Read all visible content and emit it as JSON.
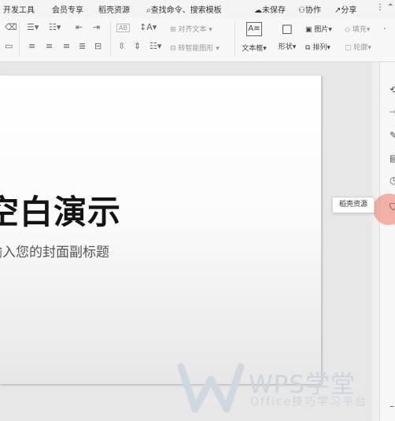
{
  "menubar": {
    "tab_dev": "开发工具",
    "tab_member": "会员专享",
    "tab_resources": "稻壳资源",
    "search_placeholder": "查找命令、搜索模板",
    "unsaved": "未保存",
    "collaborate": "协作",
    "share": "分享"
  },
  "ribbon": {
    "align_text": "对齐文本",
    "smart_shape": "转智能图形",
    "textbox": "文本框",
    "shape": "形状",
    "picture": "图片",
    "arrange": "排列",
    "fill": "填充",
    "outline": "轮廓",
    "font_size_box": "AB"
  },
  "slide": {
    "title": "空白演示",
    "subtitle": "输入您的封面副标题"
  },
  "tooltip": "稻壳资源",
  "watermark": {
    "main": "WPS学堂",
    "sub": "Office技巧学习平台"
  }
}
